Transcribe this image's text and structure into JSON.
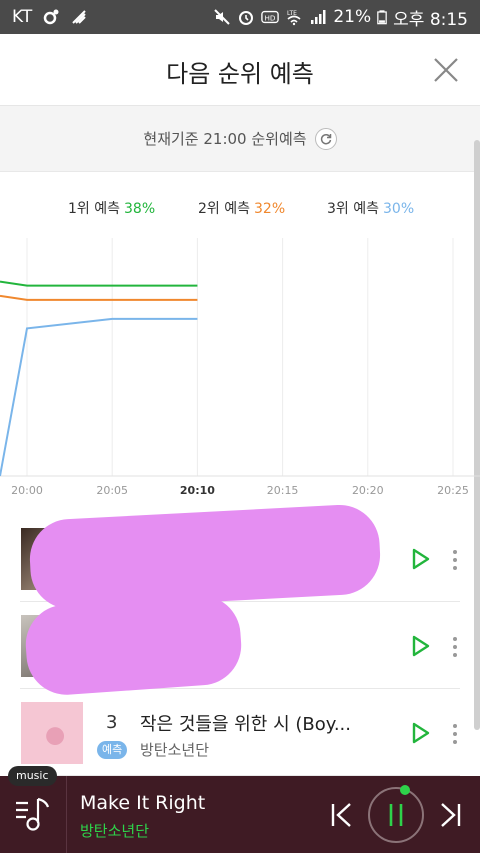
{
  "status_bar": {
    "carrier": "KT",
    "battery": "21%",
    "time": "오후 8:15",
    "icons": [
      "location-icon",
      "app-notification-icon",
      "mute-icon",
      "alarm-icon",
      "hd-icon",
      "lte-wifi-icon",
      "signal-icon",
      "battery-icon"
    ]
  },
  "header": {
    "title": "다음 순위 예측",
    "close_icon": "close-icon"
  },
  "basis": {
    "label": "현재기준 21:00 순위예측",
    "refresh_icon": "refresh-icon"
  },
  "legend": [
    {
      "label": "1위 예측",
      "value": "38%",
      "color": "#22b53c"
    },
    {
      "label": "2위 예측",
      "value": "32%",
      "color": "#f0882e"
    },
    {
      "label": "3위 예측",
      "value": "30%",
      "color": "#7ab5ea"
    }
  ],
  "chart_data": {
    "type": "line",
    "x": [
      "20:00",
      "20:05",
      "20:10",
      "20:15",
      "20:20",
      "20:25"
    ],
    "current_x": "20:10",
    "ylim": [
      0,
      50
    ],
    "grid": true,
    "series": [
      {
        "name": "1위 예측",
        "color": "#22b53c",
        "values": [
          40,
          40,
          40
        ]
      },
      {
        "name": "2위 예측",
        "color": "#f0882e",
        "values": [
          37,
          37,
          37
        ]
      },
      {
        "name": "3위 예측",
        "color": "#7ab5ea",
        "values": [
          31,
          33,
          33
        ]
      }
    ]
  },
  "songs": [
    {
      "rank": "",
      "title": "",
      "artist": "",
      "badge": "",
      "obscured": true
    },
    {
      "rank": "",
      "title": "",
      "artist": "",
      "badge": "",
      "obscured": true
    },
    {
      "rank": "3",
      "title": "작은 것들을 위한 시 (Boy...",
      "artist": "방탄소년단",
      "badge": "예측",
      "obscured": false
    }
  ],
  "player": {
    "label": "music",
    "title": "Make It Right",
    "artist": "방탄소년단",
    "accent": "#2ed24a"
  }
}
